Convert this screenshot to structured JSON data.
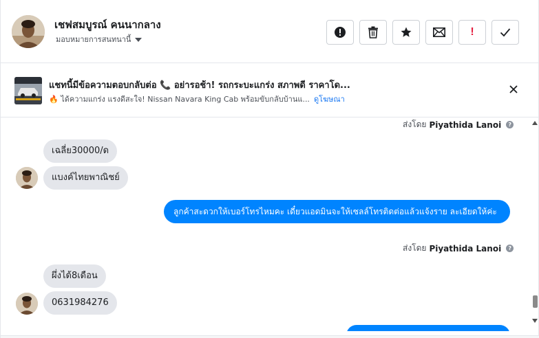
{
  "header": {
    "contact_name": "เชฟสมบูรณ์ คนนากลาง",
    "assign_label": "มอบหมายการสนทนานี้",
    "actions": [
      {
        "icon": "exclamation-circle-icon",
        "label": ""
      },
      {
        "icon": "trash-icon",
        "label": ""
      },
      {
        "icon": "star-icon",
        "label": ""
      },
      {
        "icon": "envelope-icon",
        "label": ""
      },
      {
        "icon": "exclamation-red-icon",
        "label": "!"
      },
      {
        "icon": "checkmark-icon",
        "label": ""
      }
    ]
  },
  "ad": {
    "title": "แชทนี้มีข้อความตอบกลับต่อ 📞 อย่ารอช้า! รถกระบะแกร่ง สภาพดี ราคาโด...",
    "subtitle": "🔥 ได้ความแกร่ง แรงดีสะใจ! Nissan Navara King Cab พร้อมขับกลับบ้านแ...",
    "link": "ดูโฆษณา"
  },
  "chat": {
    "sent_by_prefix": "ส่งโดย",
    "sender": "Piyathida Lanoi",
    "messages_incoming_1": [
      "เฉลี่ย30000/ด",
      "แบงค์ไทยพาณิชย์"
    ],
    "message_outgoing_1": "ลูกค้าสะดวกให้เบอร์โทรไหมคะ เดี๋ยวแอดมินจะให้เซลล์โทรติดต่อแล้วแจ้งราย ละเอียดให้ค่ะ",
    "messages_incoming_2": [
      "ผึ่งได้8เดือน",
      "0631984276"
    ]
  },
  "colors": {
    "outgoing_bubble": "#0084ff",
    "incoming_bubble": "#e4e6eb",
    "link": "#1877f2",
    "alert_red": "#e41e3f"
  }
}
